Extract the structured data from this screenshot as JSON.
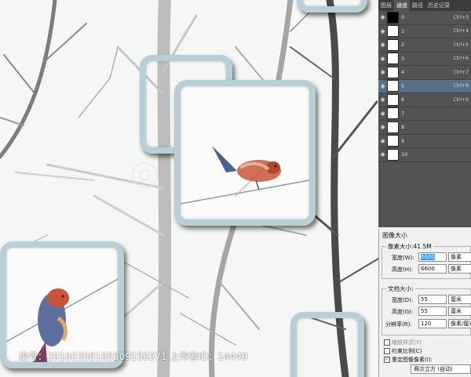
{
  "watermark": "编号：20160308165509150371 上传者ID：14449",
  "channels_panel": {
    "tabs": [
      {
        "label": "图层",
        "active": false
      },
      {
        "label": "通道",
        "active": true
      },
      {
        "label": "路径",
        "active": false
      },
      {
        "label": "历史记录",
        "active": false
      }
    ],
    "rows": [
      {
        "name": "0",
        "shortcut": "Ctrl+3",
        "selected": false,
        "thumb": "black"
      },
      {
        "name": "1",
        "shortcut": "Ctrl+4",
        "selected": false,
        "thumb": "white"
      },
      {
        "name": "2",
        "shortcut": "Ctrl+5",
        "selected": false,
        "thumb": "white"
      },
      {
        "name": "3",
        "shortcut": "Ctrl+6",
        "selected": false,
        "thumb": "white"
      },
      {
        "name": "4",
        "shortcut": "Ctrl+7",
        "selected": false,
        "thumb": "white"
      },
      {
        "name": "5",
        "shortcut": "Ctrl+8",
        "selected": true,
        "thumb": "white"
      },
      {
        "name": "6",
        "shortcut": "Ctrl+9",
        "selected": false,
        "thumb": "white"
      },
      {
        "name": "7",
        "shortcut": "",
        "selected": false,
        "thumb": "white"
      },
      {
        "name": "8",
        "shortcut": "",
        "selected": false,
        "thumb": "white"
      },
      {
        "name": "9",
        "shortcut": "",
        "selected": false,
        "thumb": "white"
      },
      {
        "name": "10",
        "shortcut": "",
        "selected": false,
        "thumb": "white"
      }
    ]
  },
  "image_size_dialog": {
    "title": "图像大小",
    "pixel_group_label": "像素大小:41.5M",
    "width_label": "宽度(W):",
    "width_value": "6600",
    "width_unit": "像素",
    "height_label": "高度(H):",
    "height_value": "6600",
    "height_unit": "像素",
    "doc_group_label": "文档大小:",
    "doc_width_label": "宽度(D):",
    "doc_width_value": "55",
    "doc_width_unit": "厘米",
    "doc_height_label": "高度(G):",
    "doc_height_value": "55",
    "doc_height_unit": "厘米",
    "resolution_label": "分辨率(R):",
    "resolution_value": "120",
    "resolution_unit": "像素/厘米",
    "scale_styles_label": "缩放样式(Y)",
    "constrain_label": "约束比例(C)",
    "resample_label": "重定图像像素(I):",
    "resample_value": "两次立方 (自动)"
  }
}
